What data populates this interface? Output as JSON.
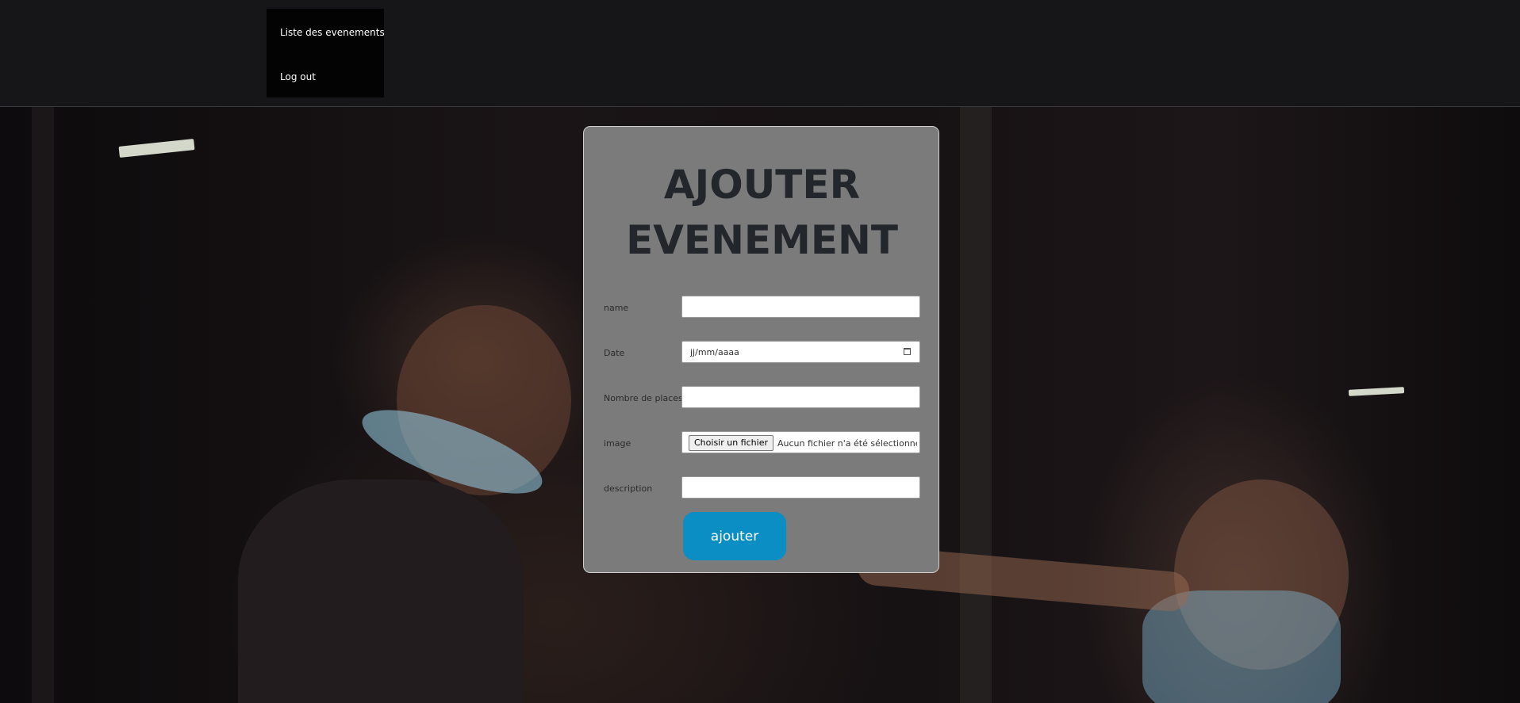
{
  "nav": {
    "items": [
      {
        "label": "Liste des evenements"
      },
      {
        "label": "Log out"
      }
    ]
  },
  "form": {
    "title_line1": "AJOUTER",
    "title_line2": "EVENEMENT",
    "fields": {
      "name": {
        "label": "name",
        "value": ""
      },
      "date": {
        "label": "Date",
        "placeholder": "jj/mm/aaaa",
        "icon": "calendar-icon"
      },
      "places": {
        "label": "Nombre de places",
        "value": ""
      },
      "image": {
        "label": "image",
        "button_label": "Choisir un fichier",
        "status": "Aucun fichier n'a été sélectionné"
      },
      "description": {
        "label": "description",
        "value": ""
      }
    },
    "submit_label": "ajouter"
  },
  "colors": {
    "topbar": "#161619",
    "nav_menu": "#030303",
    "panel": "#7b7b7b",
    "title": "#23262b",
    "submit": "#0a8ec4"
  }
}
